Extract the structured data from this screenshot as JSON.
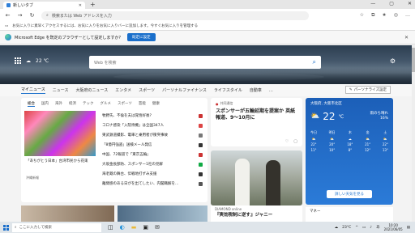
{
  "browser": {
    "tab_title": "新しいタブ",
    "new_tab": "+",
    "address_placeholder": "検索または Web アドレスを入力",
    "favorites_text": "お気に入りに素早くアクセスするには、お気に入りをお気に入りバーに追加します。今すぐお気に入りを管理する",
    "infobar_text": "Microsoft Edge を既定のブラウザーとして設定しますか?",
    "infobar_button": "既定に設定"
  },
  "hero": {
    "weather_temp": "22 ℃",
    "search_placeholder": "Web を検索"
  },
  "nav": {
    "items": [
      "マイニュース",
      "ニュース",
      "大阪府のニュース",
      "エンタメ",
      "スポーツ",
      "パーソナルファイナンス",
      "ライフスタイル",
      "自動車"
    ],
    "more": "…",
    "personalize": "パーソナライズ設定"
  },
  "news_card": {
    "tabs": [
      "総合",
      "国内",
      "海外",
      "経済",
      "テック",
      "グルメ",
      "スポーツ",
      "芸能",
      "健康"
    ],
    "main_caption": "「あちがとう日本」台湾市民から花束",
    "main_source": "沖縄新報",
    "headlines": [
      {
        "text": "牧野氏、不倫を夫は覚悟好後?",
        "color": "#c33"
      },
      {
        "text": "コロナ感染「入院待機」は全国347人",
        "color": "#d44"
      },
      {
        "text": "東武鉄道撮影、電車と乗用者が衝突事故",
        "color": "#777"
      },
      {
        "text": "「8億円強盗」送検メール発信",
        "color": "#333"
      },
      {
        "text": "中国、72報道で「東京五輪」",
        "color": "#c33"
      },
      {
        "text": "大坂金長部防、スポンサー1社の見解",
        "color": "#1a4"
      },
      {
        "text": "海老蔵の舞台、伝戦地打ずみ支援",
        "color": "#333"
      },
      {
        "text": "離間感のある日がを出てしたい、内閣職解を…",
        "color": "#555"
      }
    ]
  },
  "feature": {
    "source": "共同通信",
    "title": "スポンサーが五輪延期を提案か 英紙報道、9～10月に",
    "likes": "♡",
    "comments": "▢"
  },
  "weather": {
    "location": "大阪府, 大阪市北区",
    "temp": "22",
    "unit": "℃",
    "condition": "雨のち晴れ",
    "humidity": "16%",
    "forecast": [
      {
        "day": "今日",
        "high": "22°",
        "low": "11°"
      },
      {
        "day": "明日",
        "high": "20°",
        "low": "10°"
      },
      {
        "day": "木",
        "high": "18°",
        "low": "8°"
      },
      {
        "day": "金",
        "high": "21°",
        "low": "12°"
      },
      {
        "day": "土",
        "high": "22°",
        "low": "13°"
      }
    ],
    "details_button": "詳しい天気を見る"
  },
  "bottom": {
    "card_source": "DIAMOND online",
    "card_title": "『実効税制に逆す』ジャニー",
    "side_text": "マネー"
  },
  "taskbar": {
    "search_placeholder": "ここに入力して検索",
    "temp": "23°C",
    "time": "10:20",
    "date": "2021/06/05"
  },
  "colors": {
    "accent": "#1a6fcb",
    "weather_bg": "#2b7bd8"
  }
}
